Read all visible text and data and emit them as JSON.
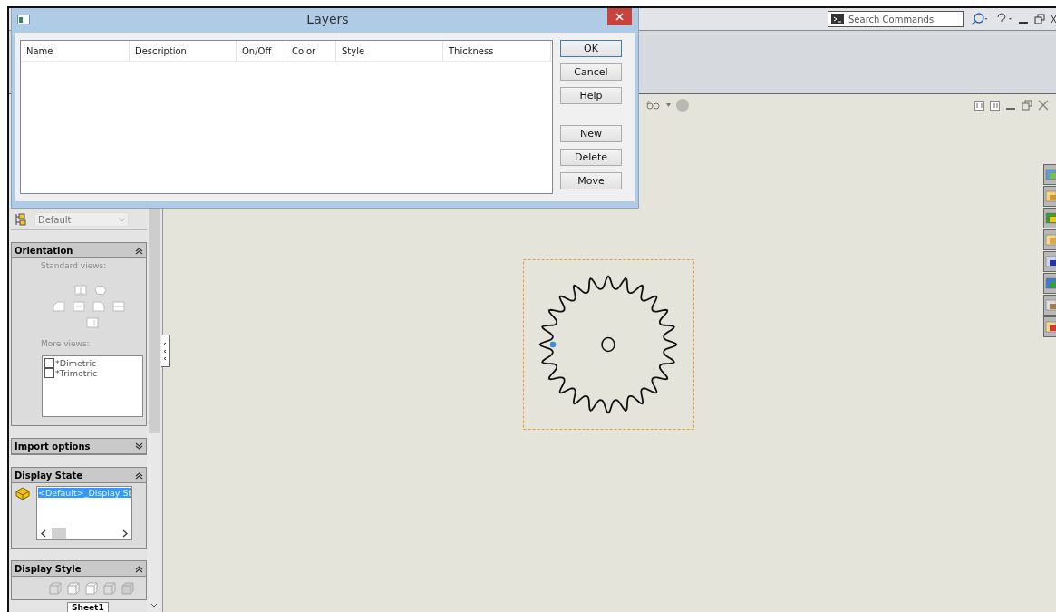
{
  "dialog": {
    "title": "Layers",
    "columns": [
      "Name",
      "Description",
      "On/Off",
      "Color",
      "Style",
      "Thickness"
    ],
    "buttons": [
      {
        "label": "OK",
        "kind": "default"
      },
      {
        "label": "Cancel",
        "kind": "normal"
      },
      {
        "label": "Help",
        "kind": "normal"
      },
      {
        "label": "New",
        "kind": "spaced"
      },
      {
        "label": "Delete",
        "kind": "normal"
      },
      {
        "label": "Move",
        "kind": "normal"
      }
    ]
  },
  "toolbar": {
    "search": {
      "placeholder": "Search Commands"
    }
  },
  "panel": {
    "config": {
      "value": "Default"
    },
    "sections": [
      {
        "kind": "orientation",
        "title": "Orientation",
        "expanded": true,
        "standard_label": "Standard views:",
        "more_label": "More views:",
        "views": [
          {
            "label": "*Dimetric",
            "checked": false
          },
          {
            "label": "*Trimetric",
            "checked": false
          }
        ]
      },
      {
        "kind": "import",
        "title": "Import options",
        "expanded": false
      },
      {
        "kind": "state",
        "title": "Display State",
        "expanded": true,
        "items": [
          {
            "label": "<Default>_Display St",
            "selected": true
          }
        ]
      },
      {
        "kind": "style",
        "title": "Display Style",
        "expanded": true
      }
    ]
  },
  "sheet_tabs": [
    {
      "label": "Sheet1",
      "selected": true
    }
  ]
}
